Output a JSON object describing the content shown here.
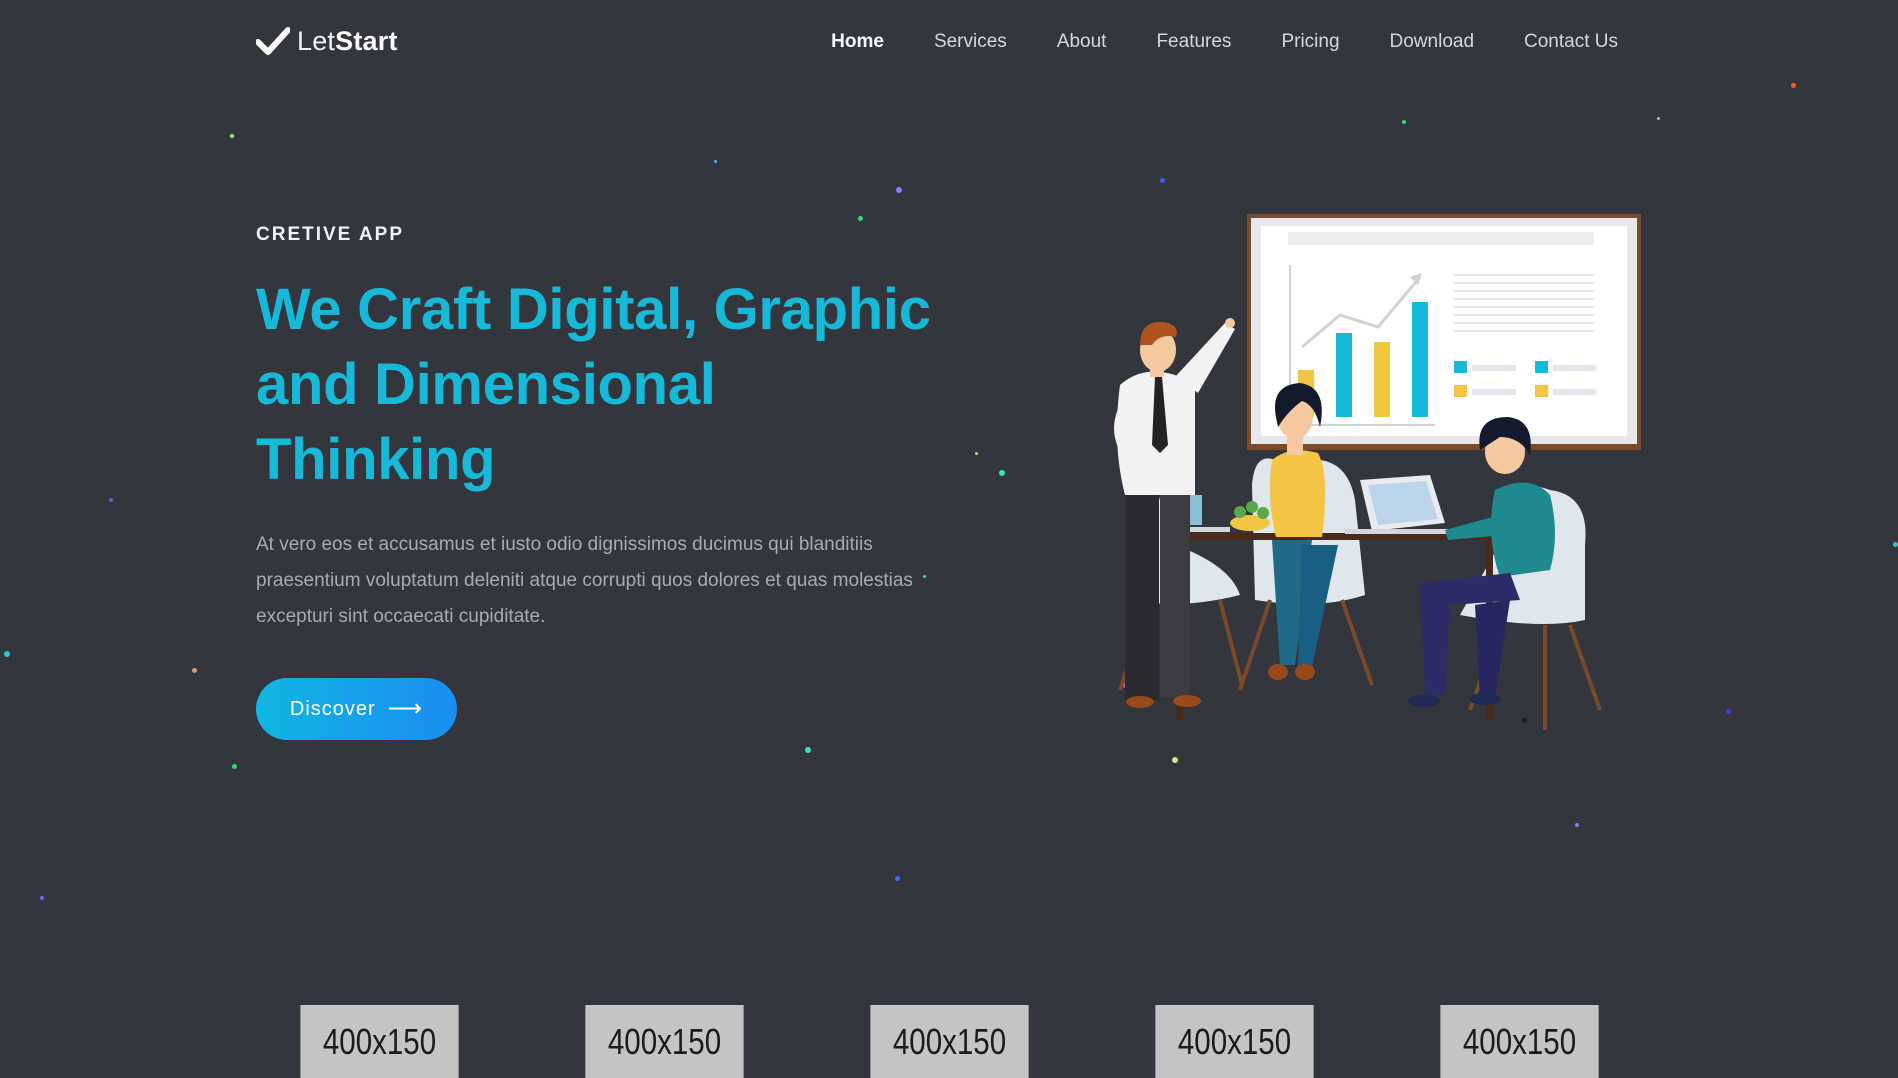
{
  "brand": {
    "name_light": "Let",
    "name_bold": "Start"
  },
  "nav": {
    "items": [
      {
        "label": "Home",
        "active": true
      },
      {
        "label": "Services",
        "active": false
      },
      {
        "label": "About",
        "active": false
      },
      {
        "label": "Features",
        "active": false
      },
      {
        "label": "Pricing",
        "active": false
      },
      {
        "label": "Download",
        "active": false
      },
      {
        "label": "Contact Us",
        "active": false
      }
    ]
  },
  "hero": {
    "eyebrow": "CRETIVE APP",
    "headline_line1": "We Craft Digital, Graphic",
    "headline_line2": "and Dimensional",
    "headline_line3": "Thinking",
    "lead": "At vero eos et accusamus et iusto odio dignissimos ducimus qui blanditiis praesentium voluptatum deleniti atque corrupti quos dolores et quas molestias excepturi sint occaecati cupiditate.",
    "cta_label": "Discover",
    "cta_arrow": "⟶"
  },
  "brands": [
    "400x150",
    "400x150",
    "400x150",
    "400x150",
    "400x150"
  ],
  "colors": {
    "background": "#33363d",
    "accent": "#17b9d9",
    "button_gradient_start": "#10b6e3",
    "button_gradient_end": "#1a8ef0",
    "chart_yellow": "#f4c542"
  }
}
